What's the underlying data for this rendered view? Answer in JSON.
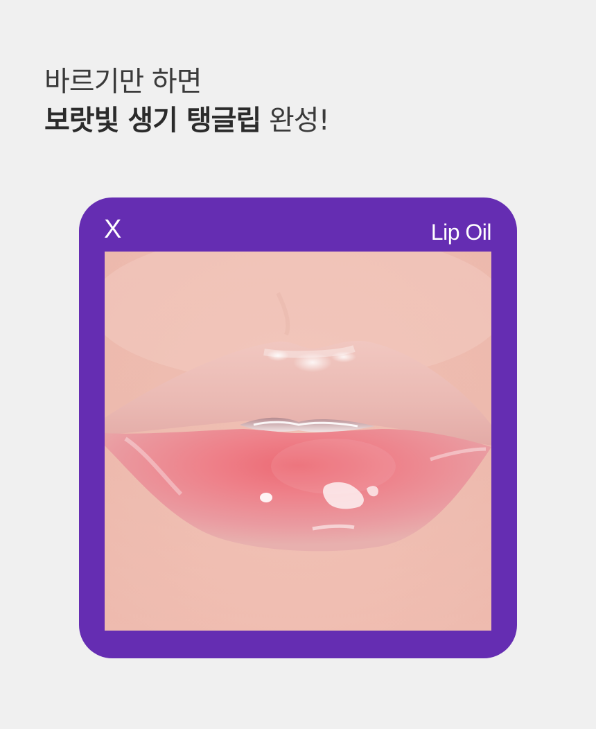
{
  "headline": {
    "line1": "바르기만 하면",
    "line2_bold": "보랏빛 생기 탱글립",
    "line2_normal": " 완성!"
  },
  "card": {
    "close_symbol": "X",
    "product_label": "Lip Oil",
    "background_color": "#652db2"
  },
  "photo": {
    "subject": "lips-closeup"
  }
}
